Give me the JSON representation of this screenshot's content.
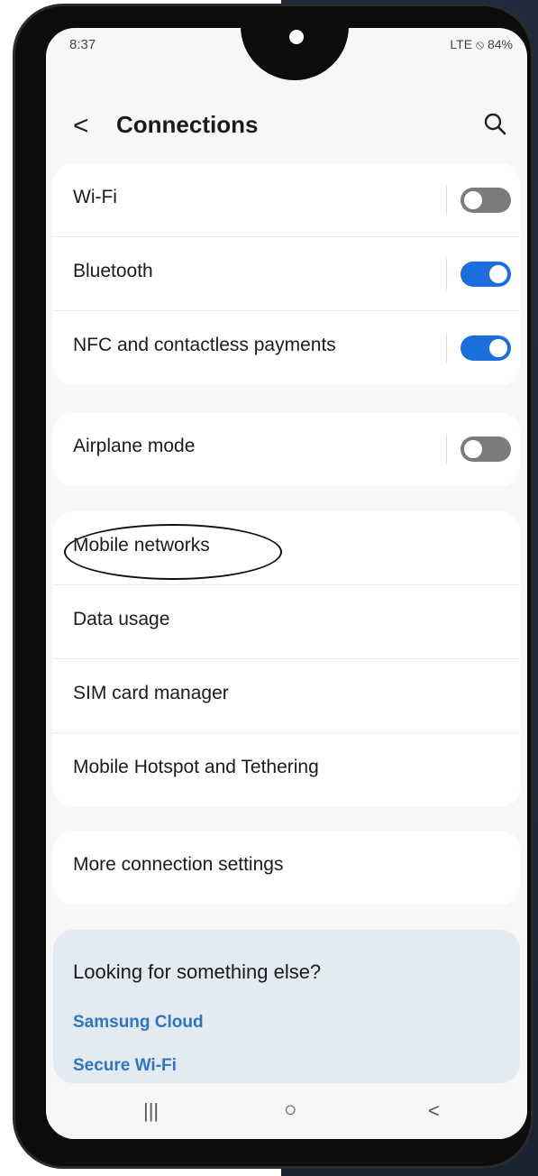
{
  "status": {
    "time": "8:37",
    "indicators": "LTE ⦸ 84%"
  },
  "header": {
    "back_glyph": "<",
    "title": "Connections"
  },
  "group1": {
    "items": [
      {
        "label": "Wi-Fi",
        "toggle": "off"
      },
      {
        "label": "Bluetooth",
        "toggle": "on"
      },
      {
        "label": "NFC and contactless payments",
        "toggle": "on"
      }
    ]
  },
  "group2": {
    "items": [
      {
        "label": "Airplane mode",
        "toggle": "off"
      }
    ]
  },
  "group3": {
    "items": [
      {
        "label": "Mobile networks"
      },
      {
        "label": "Data usage"
      },
      {
        "label": "SIM card manager"
      },
      {
        "label": "Mobile Hotspot and Tethering"
      }
    ]
  },
  "group4": {
    "items": [
      {
        "label": "More connection settings"
      }
    ]
  },
  "help": {
    "question": "Looking for something else?",
    "links": [
      "Samsung Cloud",
      "Secure Wi-Fi"
    ]
  },
  "navbar": {
    "recent": "|||",
    "home": "○",
    "back": "<"
  },
  "colors": {
    "accent": "#1c6edc",
    "link": "#2f75c0",
    "help_bg": "#e4eaf1"
  }
}
